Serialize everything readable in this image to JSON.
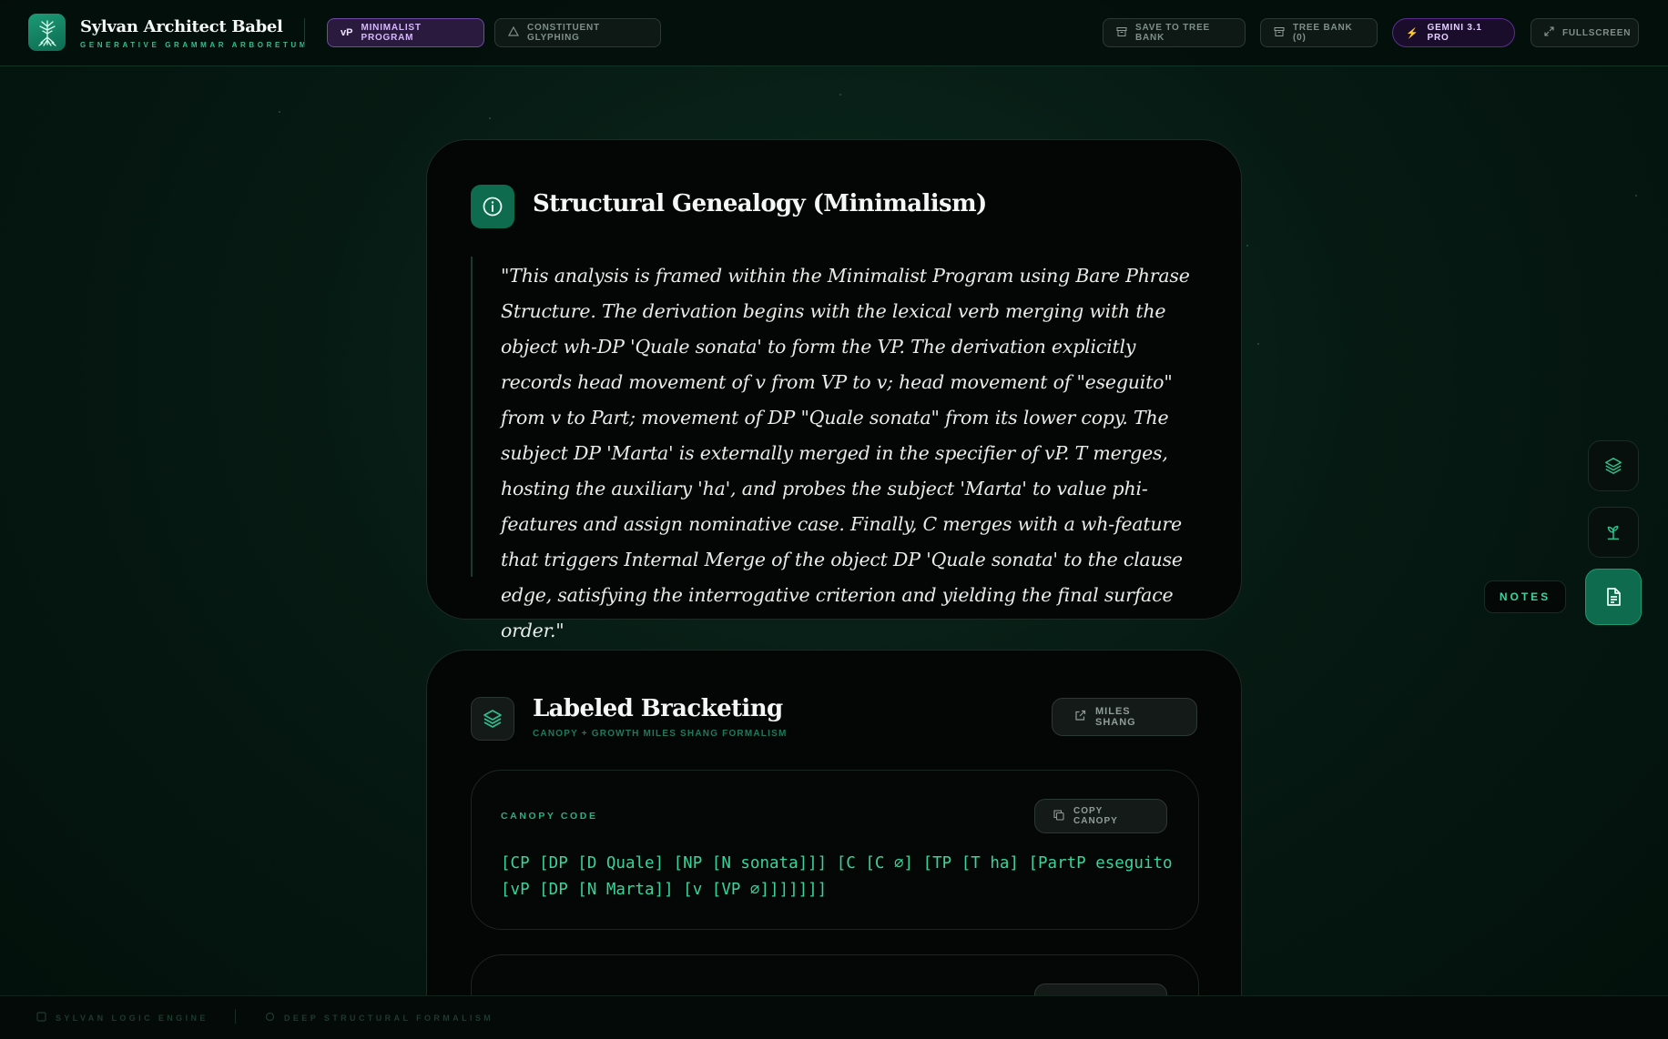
{
  "app": {
    "title": "Sylvan Architect Babel",
    "subtitle": "GENERATIVE GRAMMAR ARBORETUM"
  },
  "header": {
    "mode_tabs": [
      {
        "badge": "vP",
        "label": "MINIMALIST PROGRAM",
        "active": true
      },
      {
        "label": "CONSTITUENT GLYPHING",
        "active": false
      }
    ],
    "actions": {
      "save": "SAVE TO TREE BANK",
      "tree_bank": "TREE BANK (0)",
      "model": "GEMINI 3.1 PRO",
      "fullscreen": "FULLSCREEN"
    }
  },
  "genealogy": {
    "title": "Structural Genealogy (Minimalism)",
    "text": "\"This analysis is framed within the Minimalist Program using Bare Phrase Structure. The derivation begins with the lexical verb merging with the object wh-DP 'Quale sonata' to form the VP. The derivation explicitly records head movement of v from VP to v; head movement of \"eseguito\" from v to Part; movement of DP \"Quale sonata\" from its lower copy. The subject DP 'Marta' is externally merged in the specifier of vP. T merges, hosting the auxiliary 'ha', and probes the subject 'Marta' to value phi-features and assign nominative case. Finally, C merges with a wh-feature that triggers Internal Merge of the object DP 'Quale sonata' to the clause edge, satisfying the interrogative criterion and yielding the final surface order.\""
  },
  "bracketing": {
    "title": "Labeled Bracketing",
    "subtitle": "CANOPY + GROWTH MILES SHANG FORMALISM",
    "miles_button": "MILES SHANG",
    "canopy": {
      "label": "CANOPY CODE",
      "copy_button": "COPY CANOPY",
      "code": "[CP [DP [D Quale] [NP [N sonata]]] [C [C ∅] [TP [T ha] [PartP eseguito [vP [DP [N Marta]] [v [VP ∅]]]]]]]"
    }
  },
  "side_rail": {
    "notes_label": "NOTES"
  },
  "footer": {
    "engine": "SYLVAN LOGIC ENGINE",
    "formalism": "DEEP STRUCTURAL FORMALISM"
  },
  "colors": {
    "accent": "#2fbf8f",
    "purple_active": "#6f4aa6",
    "card_bg": "#030604",
    "code": "#39d39c"
  }
}
